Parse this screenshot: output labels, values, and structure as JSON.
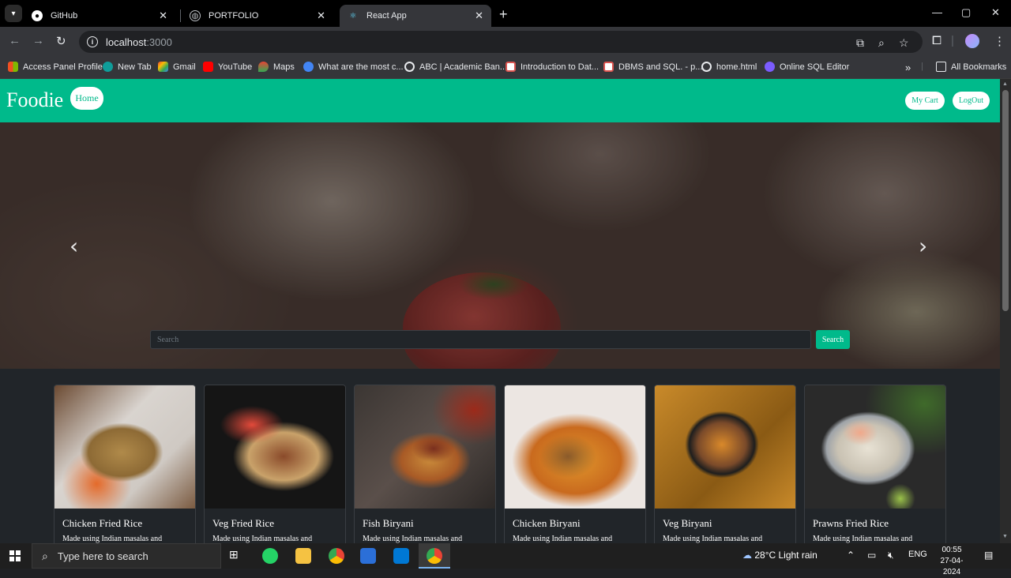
{
  "browser": {
    "tabs": [
      {
        "title": "GitHub",
        "icon": "github-icon",
        "active": false
      },
      {
        "title": "PORTFOLIO",
        "icon": "globe-icon",
        "active": false
      },
      {
        "title": "React App",
        "icon": "react-icon",
        "active": true
      }
    ],
    "url_host": "localhost",
    "url_port": ":3000",
    "bookmarks": [
      {
        "label": "Access Panel Profile",
        "color": "#f25022"
      },
      {
        "label": "New Tab",
        "color": "#0f9d9a"
      },
      {
        "label": "Gmail",
        "color": "#ea4335"
      },
      {
        "label": "YouTube",
        "color": "#ff0000"
      },
      {
        "label": "Maps",
        "color": "#34a853"
      },
      {
        "label": "What are the most c...",
        "color": "#4285f4"
      },
      {
        "label": "ABC | Academic Ban...",
        "color": "#e8eaed"
      },
      {
        "label": "Introduction to Dat...",
        "color": "#d9534f"
      },
      {
        "label": "DBMS and SQL. - p...",
        "color": "#d9534f"
      },
      {
        "label": "home.html",
        "color": "#e8eaed"
      },
      {
        "label": "Online SQL Editor",
        "color": "#7b5cff"
      }
    ],
    "all_bookmarks": "All Bookmarks"
  },
  "app": {
    "brand": "Foodie",
    "nav_home": "Home",
    "nav_cart": "My Cart",
    "nav_logout": "LogOut",
    "accent": "#00ba8b",
    "search": {
      "placeholder": "Search",
      "button": "Search"
    },
    "cards": [
      {
        "title": "Chicken Fried Rice",
        "desc": "Made using Indian masalas and"
      },
      {
        "title": "Veg Fried Rice",
        "desc": "Made using Indian masalas and"
      },
      {
        "title": "Fish Biryani",
        "desc": "Made using Indian masalas and"
      },
      {
        "title": "Chicken Biryani",
        "desc": "Made using Indian masalas and"
      },
      {
        "title": "Veg Biryani",
        "desc": "Made using Indian masalas and"
      },
      {
        "title": "Prawns Fried Rice",
        "desc": "Made using Indian masalas and"
      }
    ]
  },
  "taskbar": {
    "search_placeholder": "Type here to search",
    "weather": "28°C  Light rain",
    "language": "ENG",
    "time": "00:55",
    "date": "27-04-2024"
  }
}
